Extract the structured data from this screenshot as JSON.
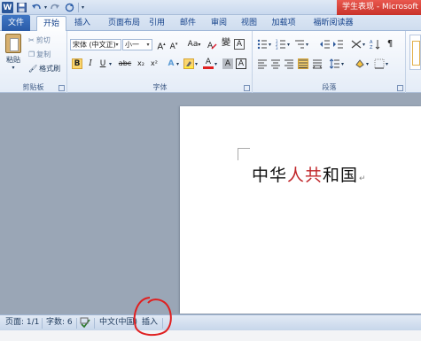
{
  "title_bar": {
    "app_letter": "W",
    "document_title": "学生表现 - Microsoft W"
  },
  "tabs": [
    {
      "label": "文件"
    },
    {
      "label": "开始"
    },
    {
      "label": "插入"
    },
    {
      "label": "页面布局"
    },
    {
      "label": "引用"
    },
    {
      "label": "邮件"
    },
    {
      "label": "审阅"
    },
    {
      "label": "视图"
    },
    {
      "label": "加载项"
    },
    {
      "label": "福昕阅读器"
    }
  ],
  "clipboard": {
    "paste_label": "粘贴",
    "cut_label": "剪切",
    "copy_label": "复制",
    "format_painter_label": "格式刷",
    "group_label": "剪贴板"
  },
  "font": {
    "font_name": "宋体 (中文正)",
    "font_size": "小一",
    "aa_label": "Aa",
    "wen_glyph": "變",
    "a_glyph": "A",
    "group_label": "字体",
    "bold": "B",
    "italic": "I",
    "underline": "U",
    "strike": "abc",
    "subscript": "x₂",
    "superscript": "x²",
    "font_color_letter": "A",
    "char_shading_letter": "A",
    "char_border_letter": "A"
  },
  "paragraph": {
    "group_label": "段落"
  },
  "document": {
    "text_part1": "中华",
    "text_red": "人共",
    "text_part2": "和国",
    "para_mark": "↵",
    "red_color": "#c0262a"
  },
  "status_bar": {
    "page": "页面: 1/1",
    "word_count": "字数: 6",
    "language": "中文(中国)",
    "mode": "插入"
  },
  "colors": {
    "file_tab": "#2b579a",
    "annotation": "#e02020"
  }
}
